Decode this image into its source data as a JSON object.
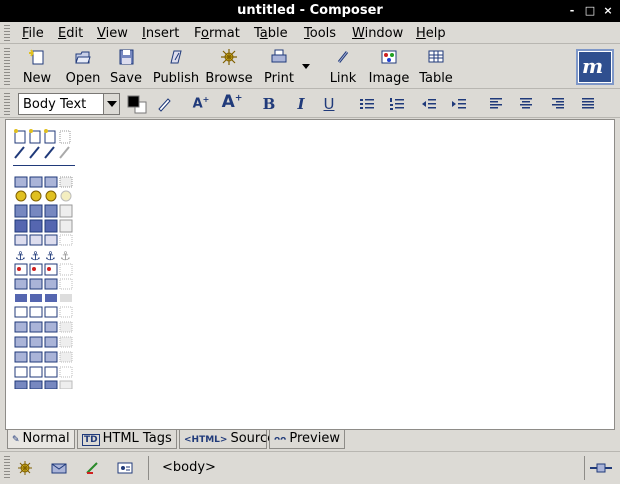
{
  "window": {
    "title": "untitled - Composer"
  },
  "titlebar_buttons": [
    "-",
    "□",
    "×"
  ],
  "menu": [
    "File",
    "Edit",
    "View",
    "Insert",
    "Format",
    "Table",
    "Tools",
    "Window",
    "Help"
  ],
  "menu_mnemonics": [
    "F",
    "E",
    "V",
    "I",
    "o",
    "a",
    "T",
    "W",
    "H"
  ],
  "toolbar": {
    "new": "New",
    "open": "Open",
    "save": "Save",
    "publish": "Publish",
    "browse": "Browse",
    "print": "Print",
    "link": "Link",
    "image": "Image",
    "table": "Table"
  },
  "format_toolbar": {
    "paragraph_style": "Body Text",
    "text_color": "#000000",
    "background_color": "#ffffff"
  },
  "tabs": [
    {
      "icon": "pen-icon",
      "label": "Normal"
    },
    {
      "icon": "TD",
      "label": "HTML Tags"
    },
    {
      "icon": "<HTML>",
      "label": "Source"
    },
    {
      "icon": "eyeglasses-icon",
      "label": "Preview"
    }
  ],
  "status": {
    "structure": "<body>"
  },
  "colors": {
    "accent": "#2f4f8f",
    "toolbar_bg": "#dcdad5"
  }
}
